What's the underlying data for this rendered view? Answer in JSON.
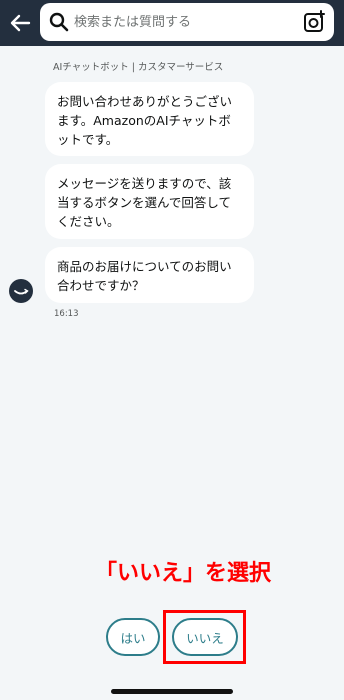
{
  "header": {
    "back_icon": "arrow-left-icon",
    "search_placeholder": "検索または質問する",
    "search_icon": "search-icon",
    "camera_icon": "camera-icon",
    "bg_color": "#232f3e"
  },
  "chat": {
    "title": "AIチャットボット | カスタマーサービス",
    "messages": [
      "お問い合わせありがとうございます。AmazonのAIチャットボットです。",
      "メッセージを送りますので、該当するボタンを選んで回答してください。",
      "商品のお届けについてのお問い合わせですか？"
    ],
    "timestamp": "16:13",
    "avatar_icon": "amazon-smile-icon"
  },
  "annotation": {
    "text": "「いいえ」を選択",
    "color": "#ff0000"
  },
  "quick_replies": {
    "yes": "はい",
    "no": "いいえ",
    "accent": "#2d7d8a"
  }
}
